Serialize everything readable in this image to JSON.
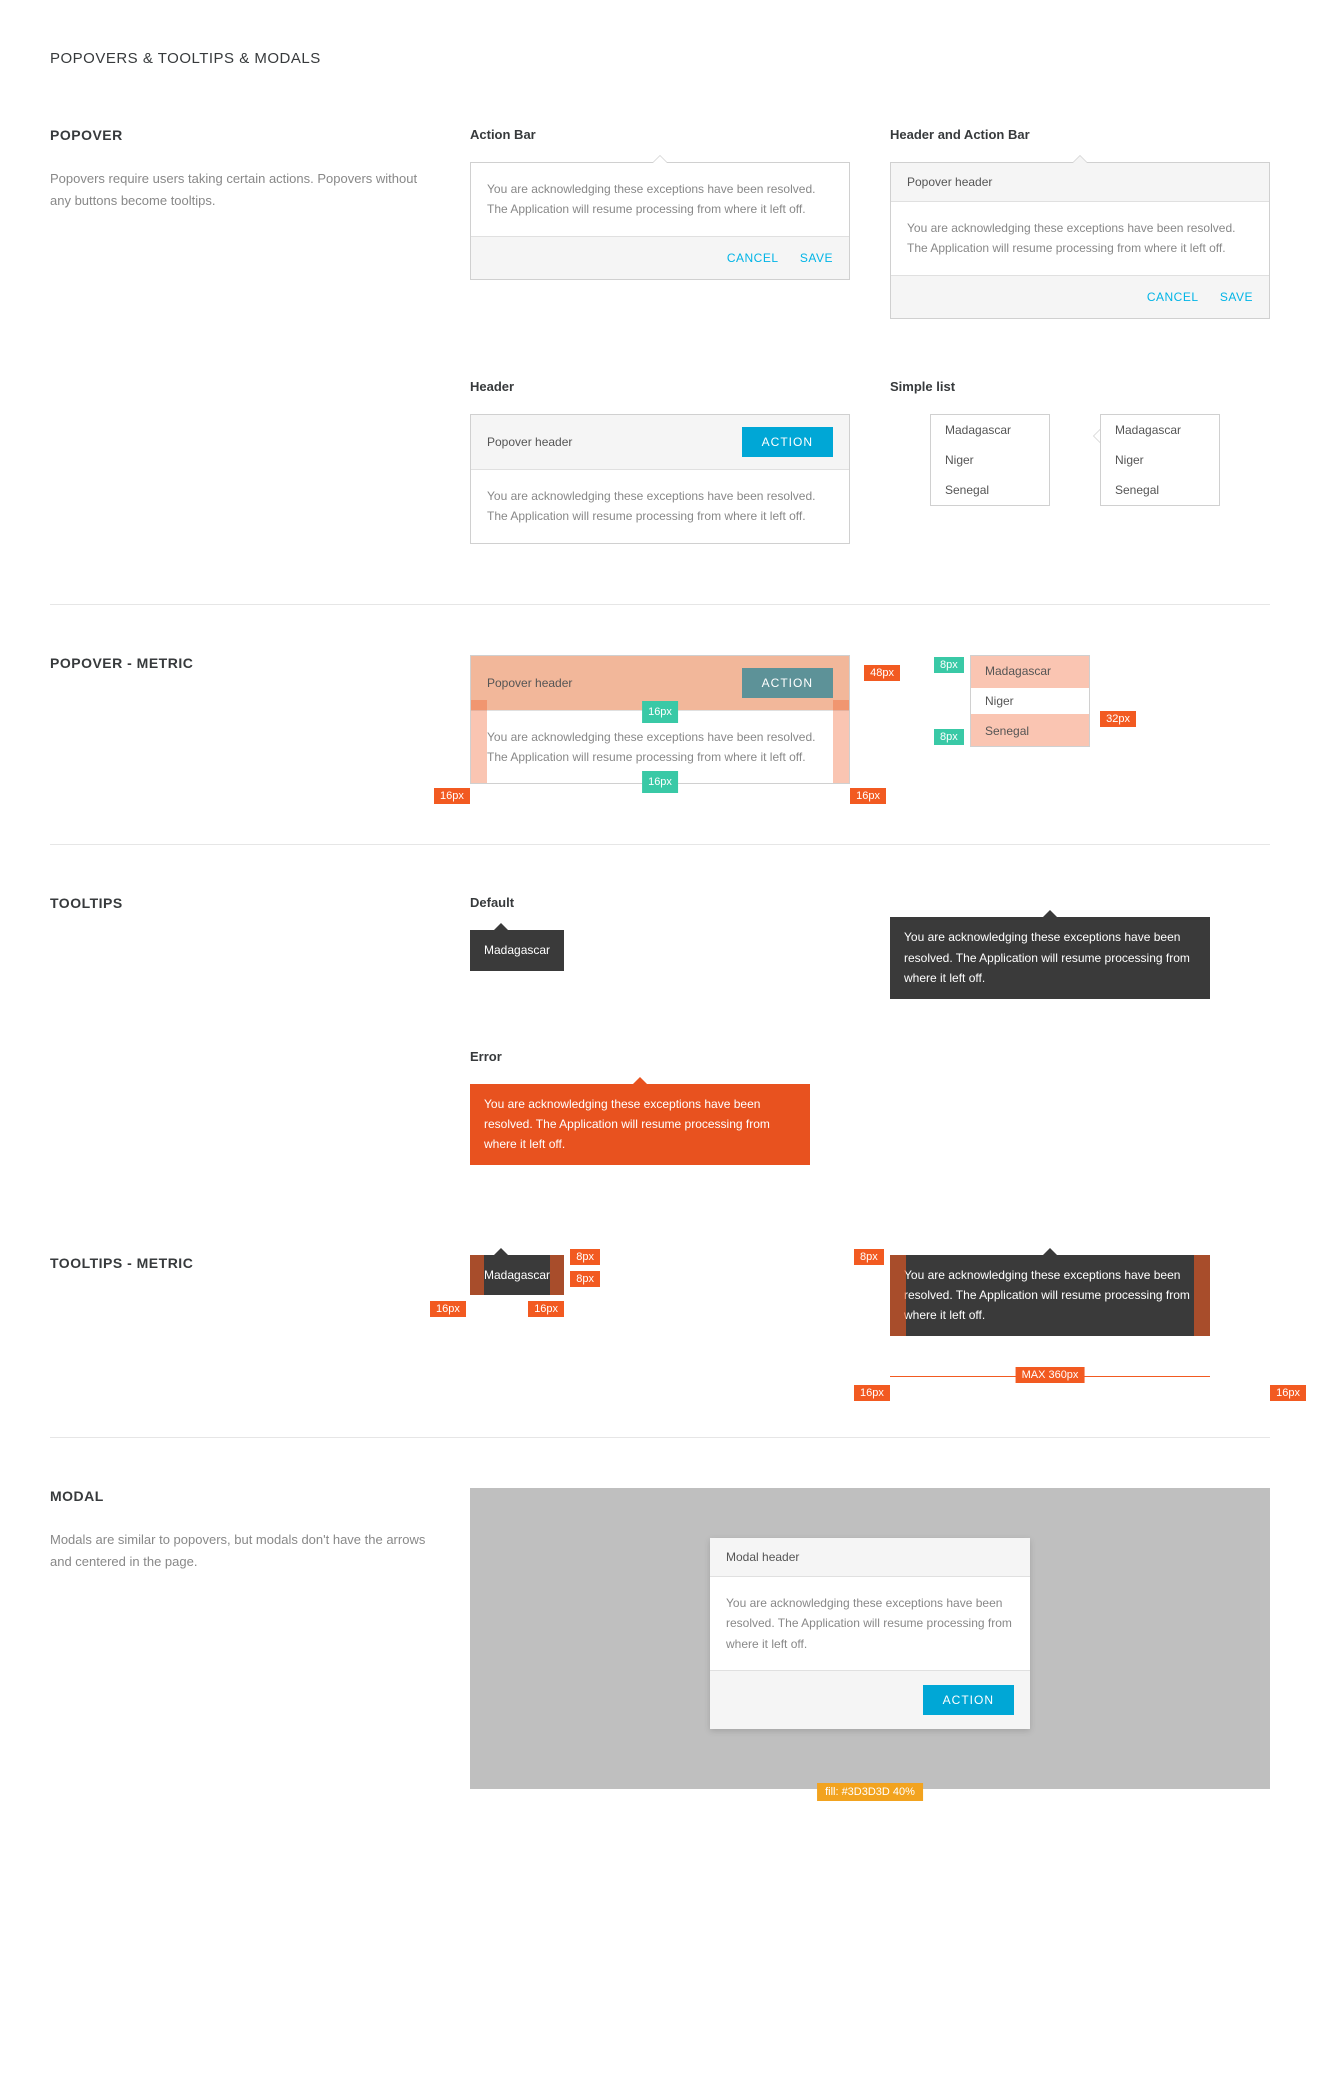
{
  "page": {
    "title": "POPOVERS & TOOLTIPS & MODALS"
  },
  "popover_section": {
    "heading": "POPOVER",
    "desc": "Popovers require users taking certain actions. Popovers without any buttons become tooltips.",
    "action_bar_label": "Action Bar",
    "header_action_bar_label": "Header and Action Bar",
    "header_label": "Header",
    "simple_list_label": "Simple list",
    "body_text": "You are acknowledging these exceptions have been resolved. The Application will resume processing from where it left off.",
    "header_text": "Popover header",
    "cancel": "CANCEL",
    "save": "SAVE",
    "action": "ACTION",
    "list_items": [
      "Madagascar",
      "Niger",
      "Senegal"
    ]
  },
  "popover_metric": {
    "heading": "POPOVER - METRIC",
    "m48": "48px",
    "m32": "32px",
    "m16": "16px",
    "m8": "8px"
  },
  "tooltips": {
    "heading": "TOOLTIPS",
    "default_label": "Default",
    "error_label": "Error",
    "single": "Madagascar",
    "long": "You are acknowledging these exceptions have been resolved. The Application will resume processing from where it left off."
  },
  "tooltips_metric": {
    "heading": "TOOLTIPS - METRIC",
    "m8": "8px",
    "m16": "16px",
    "max": "MAX 360px"
  },
  "modal": {
    "heading": "MODAL",
    "desc": "Modals are similar to popovers, but modals don't have the arrows and centered in the page.",
    "header": "Modal header",
    "body": "You are acknowledging these exceptions have been resolved. The Application will resume processing from where it left off.",
    "action": "ACTION",
    "fill_label": "fill: #3D3D3D 40%"
  }
}
